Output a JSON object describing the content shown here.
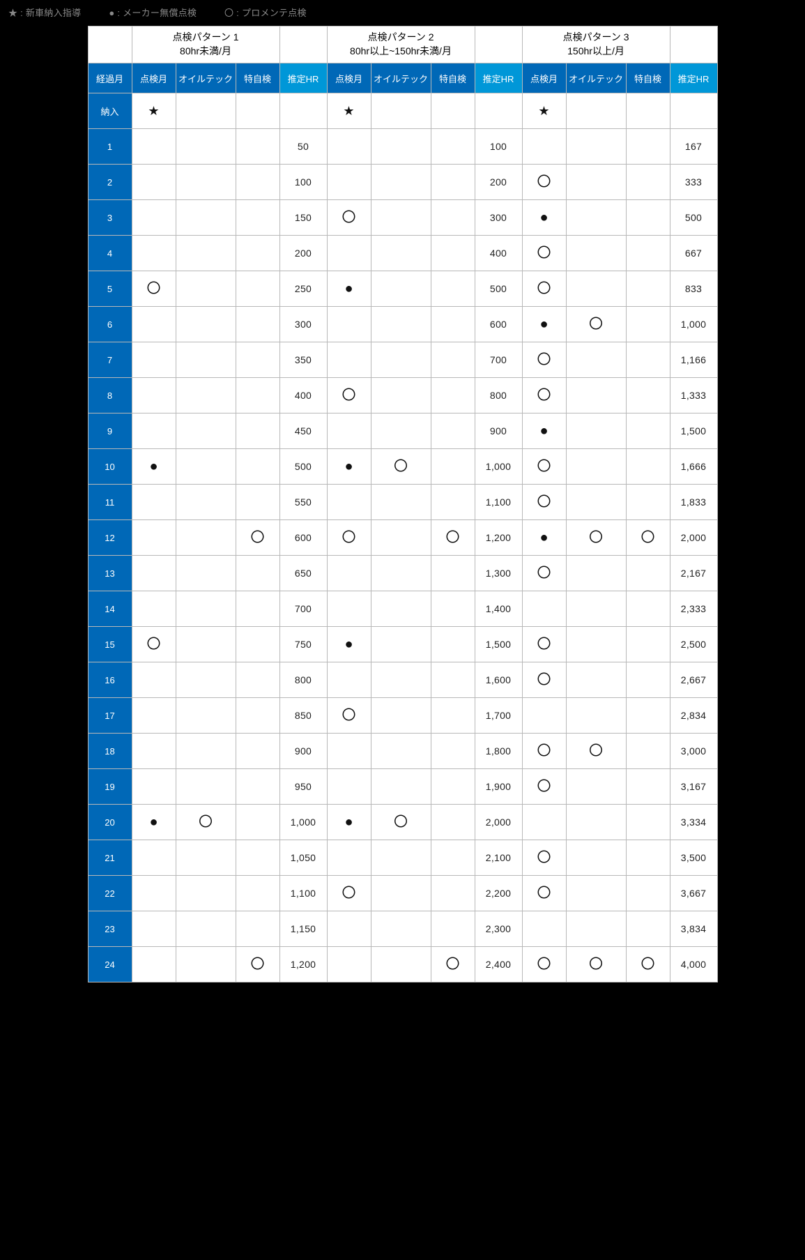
{
  "legend": {
    "star": "新車納入指導",
    "dot": "メーカー無償点検",
    "circle": "プロメンテ点検"
  },
  "headers": {
    "month": "経過月",
    "sub": [
      "点検月",
      "オイルテック",
      "特自検",
      "推定HR"
    ]
  },
  "groups": [
    {
      "title": "点検パターン 1",
      "sub": "80hr未満/月"
    },
    {
      "title": "点検パターン 2",
      "sub": "80hr以上~150hr未満/月"
    },
    {
      "title": "点検パターン 3",
      "sub": "150hr以上/月"
    }
  ],
  "symbols": {
    "star": "★",
    "dot": "●",
    "circle": "〇",
    "blank": ""
  },
  "rows": [
    {
      "label": "納入",
      "p1": {
        "a": "star",
        "b": "",
        "c": "",
        "hr": ""
      },
      "p2": {
        "a": "star",
        "b": "",
        "c": "",
        "hr": ""
      },
      "p3": {
        "a": "star",
        "b": "",
        "c": "",
        "hr": ""
      }
    },
    {
      "label": "1",
      "p1": {
        "a": "",
        "b": "",
        "c": "",
        "hr": "50"
      },
      "p2": {
        "a": "",
        "b": "",
        "c": "",
        "hr": "100"
      },
      "p3": {
        "a": "",
        "b": "",
        "c": "",
        "hr": "167"
      }
    },
    {
      "label": "2",
      "p1": {
        "a": "",
        "b": "",
        "c": "",
        "hr": "100"
      },
      "p2": {
        "a": "",
        "b": "",
        "c": "",
        "hr": "200"
      },
      "p3": {
        "a": "circle",
        "b": "",
        "c": "",
        "hr": "333"
      }
    },
    {
      "label": "3",
      "p1": {
        "a": "",
        "b": "",
        "c": "",
        "hr": "150"
      },
      "p2": {
        "a": "circle",
        "b": "",
        "c": "",
        "hr": "300"
      },
      "p3": {
        "a": "dot",
        "b": "",
        "c": "",
        "hr": "500"
      }
    },
    {
      "label": "4",
      "p1": {
        "a": "",
        "b": "",
        "c": "",
        "hr": "200"
      },
      "p2": {
        "a": "",
        "b": "",
        "c": "",
        "hr": "400"
      },
      "p3": {
        "a": "circle",
        "b": "",
        "c": "",
        "hr": "667"
      }
    },
    {
      "label": "5",
      "p1": {
        "a": "circle",
        "b": "",
        "c": "",
        "hr": "250"
      },
      "p2": {
        "a": "dot",
        "b": "",
        "c": "",
        "hr": "500"
      },
      "p3": {
        "a": "circle",
        "b": "",
        "c": "",
        "hr": "833"
      }
    },
    {
      "label": "6",
      "p1": {
        "a": "",
        "b": "",
        "c": "",
        "hr": "300"
      },
      "p2": {
        "a": "",
        "b": "",
        "c": "",
        "hr": "600"
      },
      "p3": {
        "a": "dot",
        "b": "circle",
        "c": "",
        "hr": "1,000"
      }
    },
    {
      "label": "7",
      "p1": {
        "a": "",
        "b": "",
        "c": "",
        "hr": "350"
      },
      "p2": {
        "a": "",
        "b": "",
        "c": "",
        "hr": "700"
      },
      "p3": {
        "a": "circle",
        "b": "",
        "c": "",
        "hr": "1,166"
      }
    },
    {
      "label": "8",
      "p1": {
        "a": "",
        "b": "",
        "c": "",
        "hr": "400"
      },
      "p2": {
        "a": "circle",
        "b": "",
        "c": "",
        "hr": "800"
      },
      "p3": {
        "a": "circle",
        "b": "",
        "c": "",
        "hr": "1,333"
      }
    },
    {
      "label": "9",
      "p1": {
        "a": "",
        "b": "",
        "c": "",
        "hr": "450"
      },
      "p2": {
        "a": "",
        "b": "",
        "c": "",
        "hr": "900"
      },
      "p3": {
        "a": "dot",
        "b": "",
        "c": "",
        "hr": "1,500"
      }
    },
    {
      "label": "10",
      "p1": {
        "a": "dot",
        "b": "",
        "c": "",
        "hr": "500"
      },
      "p2": {
        "a": "dot",
        "b": "circle",
        "c": "",
        "hr": "1,000"
      },
      "p3": {
        "a": "circle",
        "b": "",
        "c": "",
        "hr": "1,666"
      }
    },
    {
      "label": "11",
      "p1": {
        "a": "",
        "b": "",
        "c": "",
        "hr": "550"
      },
      "p2": {
        "a": "",
        "b": "",
        "c": "",
        "hr": "1,100"
      },
      "p3": {
        "a": "circle",
        "b": "",
        "c": "",
        "hr": "1,833"
      }
    },
    {
      "label": "12",
      "p1": {
        "a": "",
        "b": "",
        "c": "circle",
        "hr": "600"
      },
      "p2": {
        "a": "circle",
        "b": "",
        "c": "circle",
        "hr": "1,200"
      },
      "p3": {
        "a": "dot",
        "b": "circle",
        "c": "circle",
        "hr": "2,000"
      }
    },
    {
      "label": "13",
      "p1": {
        "a": "",
        "b": "",
        "c": "",
        "hr": "650"
      },
      "p2": {
        "a": "",
        "b": "",
        "c": "",
        "hr": "1,300"
      },
      "p3": {
        "a": "circle",
        "b": "",
        "c": "",
        "hr": "2,167"
      }
    },
    {
      "label": "14",
      "p1": {
        "a": "",
        "b": "",
        "c": "",
        "hr": "700"
      },
      "p2": {
        "a": "",
        "b": "",
        "c": "",
        "hr": "1,400"
      },
      "p3": {
        "a": "",
        "b": "",
        "c": "",
        "hr": "2,333"
      }
    },
    {
      "label": "15",
      "p1": {
        "a": "circle",
        "b": "",
        "c": "",
        "hr": "750"
      },
      "p2": {
        "a": "dot",
        "b": "",
        "c": "",
        "hr": "1,500"
      },
      "p3": {
        "a": "circle",
        "b": "",
        "c": "",
        "hr": "2,500"
      }
    },
    {
      "label": "16",
      "p1": {
        "a": "",
        "b": "",
        "c": "",
        "hr": "800"
      },
      "p2": {
        "a": "",
        "b": "",
        "c": "",
        "hr": "1,600"
      },
      "p3": {
        "a": "circle",
        "b": "",
        "c": "",
        "hr": "2,667"
      }
    },
    {
      "label": "17",
      "p1": {
        "a": "",
        "b": "",
        "c": "",
        "hr": "850"
      },
      "p2": {
        "a": "circle",
        "b": "",
        "c": "",
        "hr": "1,700"
      },
      "p3": {
        "a": "",
        "b": "",
        "c": "",
        "hr": "2,834"
      }
    },
    {
      "label": "18",
      "p1": {
        "a": "",
        "b": "",
        "c": "",
        "hr": "900"
      },
      "p2": {
        "a": "",
        "b": "",
        "c": "",
        "hr": "1,800"
      },
      "p3": {
        "a": "circle",
        "b": "circle",
        "c": "",
        "hr": "3,000"
      }
    },
    {
      "label": "19",
      "p1": {
        "a": "",
        "b": "",
        "c": "",
        "hr": "950"
      },
      "p2": {
        "a": "",
        "b": "",
        "c": "",
        "hr": "1,900"
      },
      "p3": {
        "a": "circle",
        "b": "",
        "c": "",
        "hr": "3,167"
      }
    },
    {
      "label": "20",
      "p1": {
        "a": "dot",
        "b": "circle",
        "c": "",
        "hr": "1,000"
      },
      "p2": {
        "a": "dot",
        "b": "circle",
        "c": "",
        "hr": "2,000"
      },
      "p3": {
        "a": "",
        "b": "",
        "c": "",
        "hr": "3,334"
      }
    },
    {
      "label": "21",
      "p1": {
        "a": "",
        "b": "",
        "c": "",
        "hr": "1,050"
      },
      "p2": {
        "a": "",
        "b": "",
        "c": "",
        "hr": "2,100"
      },
      "p3": {
        "a": "circle",
        "b": "",
        "c": "",
        "hr": "3,500"
      }
    },
    {
      "label": "22",
      "p1": {
        "a": "",
        "b": "",
        "c": "",
        "hr": "1,100"
      },
      "p2": {
        "a": "circle",
        "b": "",
        "c": "",
        "hr": "2,200"
      },
      "p3": {
        "a": "circle",
        "b": "",
        "c": "",
        "hr": "3,667"
      }
    },
    {
      "label": "23",
      "p1": {
        "a": "",
        "b": "",
        "c": "",
        "hr": "1,150"
      },
      "p2": {
        "a": "",
        "b": "",
        "c": "",
        "hr": "2,300"
      },
      "p3": {
        "a": "",
        "b": "",
        "c": "",
        "hr": "3,834"
      }
    },
    {
      "label": "24",
      "p1": {
        "a": "",
        "b": "",
        "c": "circle",
        "hr": "1,200"
      },
      "p2": {
        "a": "",
        "b": "",
        "c": "circle",
        "hr": "2,400"
      },
      "p3": {
        "a": "circle",
        "b": "circle",
        "c": "circle",
        "hr": "4,000"
      }
    }
  ]
}
